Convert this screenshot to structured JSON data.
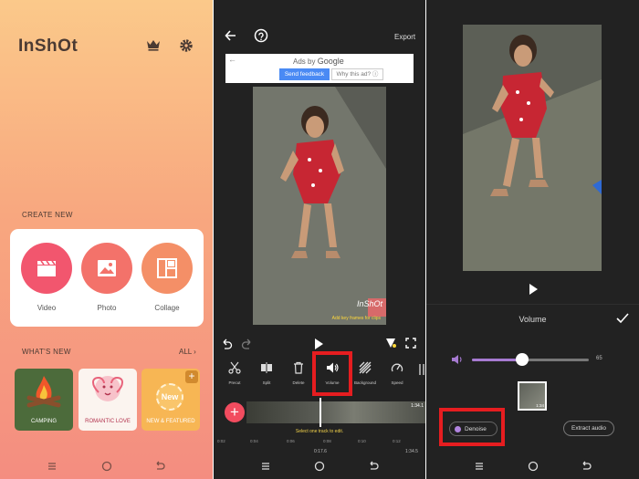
{
  "home": {
    "logo": "InShOt",
    "create_new_label": "CREATE NEW",
    "create_buttons": [
      {
        "label": "Video",
        "icon": "clapperboard-icon",
        "color": "#f2566e"
      },
      {
        "label": "Photo",
        "icon": "image-icon",
        "color": "#f3726a"
      },
      {
        "label": "Collage",
        "icon": "collage-icon",
        "color": "#f48f67"
      }
    ],
    "whats_new_label": "WHAT'S NEW",
    "all_label": "ALL",
    "tiles": [
      {
        "label": "CAMPING",
        "color": "#4c6b3b"
      },
      {
        "label": "ROMANTIC LOVE",
        "color": "#fbf4ef"
      },
      {
        "label": "NEW & FEATURED",
        "color": "#f7b654",
        "badge": "New"
      }
    ]
  },
  "editor": {
    "export_label": "Export",
    "ad": {
      "ads_by": "Ads by",
      "google": "Google",
      "send_feedback": "Send feedback",
      "why_this_ad": "Why this ad?"
    },
    "watermark": "InShOt",
    "keyframe_hint": "Add key frames for clips",
    "tools": [
      {
        "label": "Precut",
        "icon": "scissors-icon"
      },
      {
        "label": "Split",
        "icon": "split-icon"
      },
      {
        "label": "Delete",
        "icon": "trash-icon"
      },
      {
        "label": "Volume",
        "icon": "volume-icon"
      },
      {
        "label": "Background",
        "icon": "background-icon"
      },
      {
        "label": "Speed",
        "icon": "speed-icon"
      }
    ],
    "clip_duration": "1:34.1",
    "select_hint": "Select one track to edit.",
    "ruler": [
      "0:02",
      "0:04",
      "0:06",
      "0:08",
      "0:10",
      "0:12"
    ],
    "current_time": "0:17.6",
    "total_time": "1:34.5"
  },
  "volume_panel": {
    "title": "Volume",
    "volume_value": "65",
    "volume_fraction": 0.43,
    "thumb_duration": "1:34",
    "denoise_label": "Denoise",
    "extract_audio_label": "Extract audio",
    "accent_color": "#a67ad1"
  },
  "highlight_color": "#e61d20"
}
